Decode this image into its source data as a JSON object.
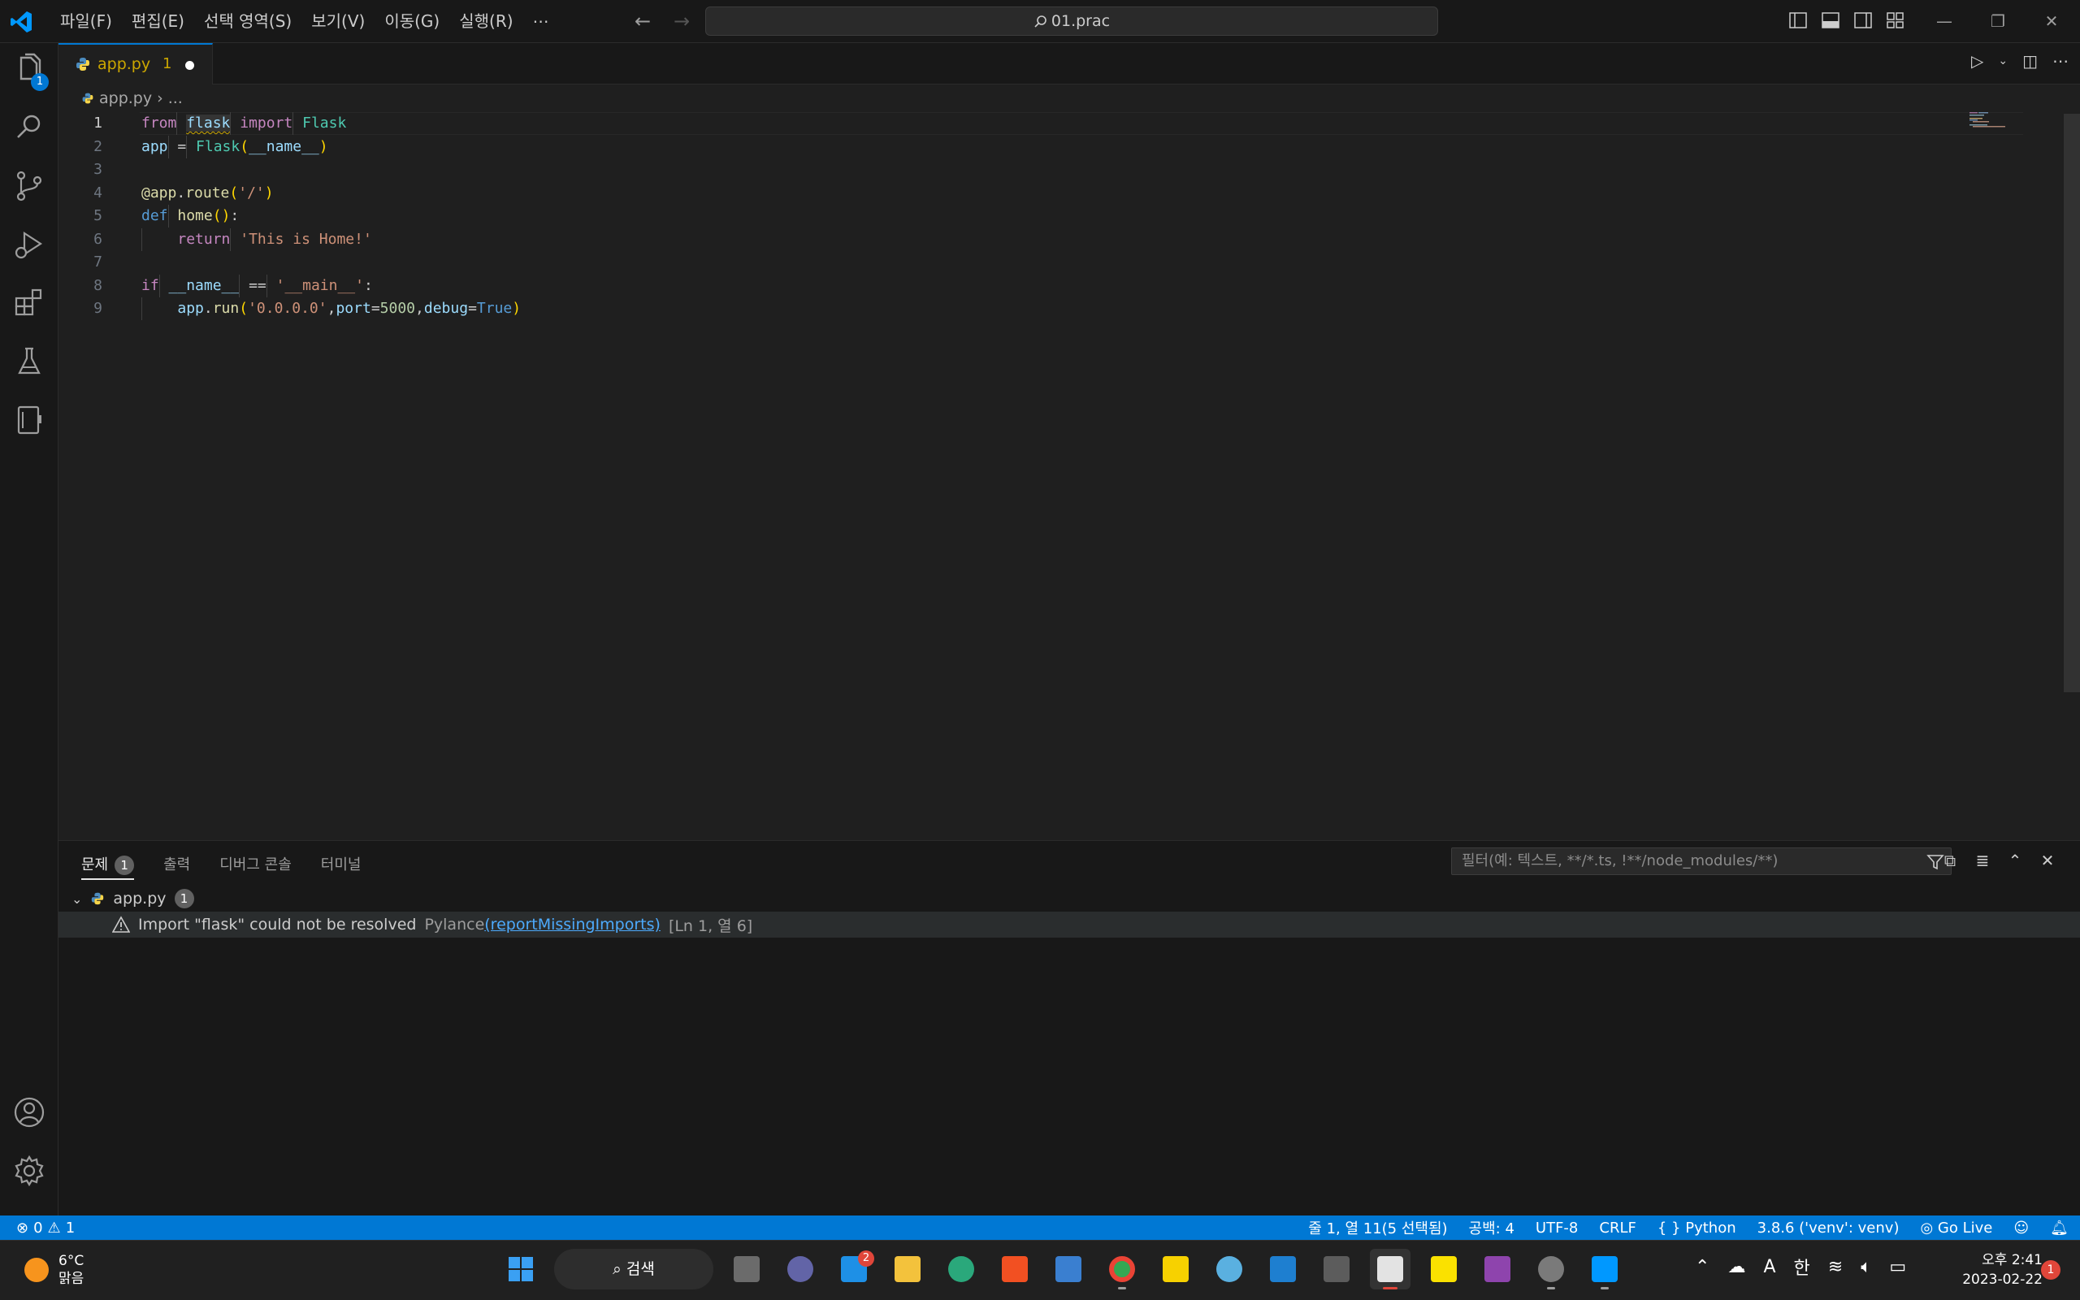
{
  "window": {
    "menus": [
      "파일(F)",
      "편집(E)",
      "선택 영역(S)",
      "보기(V)",
      "이동(G)",
      "실행(R)",
      "⋯"
    ],
    "search_text": "01.prac"
  },
  "activity": {
    "explorer_badge": "1"
  },
  "tab": {
    "name": "app.py",
    "problem_count": "1"
  },
  "breadcrumb": {
    "file": "app.py",
    "rest": "..."
  },
  "editor": {
    "line_numbers": [
      "1",
      "2",
      "3",
      "4",
      "5",
      "6",
      "7",
      "8",
      "9"
    ],
    "lines": [
      "from flask import Flask",
      "app = Flask(__name__)",
      "",
      "@app.route('/')",
      "def home():",
      "    return 'This is Home!'",
      "",
      "if __name__ == '__main__':",
      "    app.run('0.0.0.0',port=5000,debug=True)"
    ]
  },
  "panel": {
    "tabs": [
      "문제",
      "출력",
      "디버그 콘솔",
      "터미널"
    ],
    "problems_badge": "1",
    "filter_placeholder": "필터(예: 텍스트, **/*.ts, !**/node_modules/**)",
    "file_name": "app.py",
    "file_count": "1",
    "problem": {
      "message": "Import \"flask\" could not be resolved",
      "source": "Pylance",
      "code": "(reportMissingImports)",
      "position": "[Ln 1, 열 6]"
    }
  },
  "statusbar": {
    "errors": "0",
    "warnings": "1",
    "cursor": "줄 1, 열 11(5 선택됨)",
    "spaces": "공백: 4",
    "encoding": "UTF-8",
    "eol": "CRLF",
    "language": "Python",
    "interpreter": "3.8.6 ('venv': venv)",
    "golive": "Go Live"
  },
  "taskbar": {
    "temperature": "6°C",
    "weather": "맑음",
    "search_label": "검색",
    "mail_badge": "2",
    "ime": "한",
    "font_icon": "A",
    "time": "오후 2:41",
    "date": "2023-02-22",
    "notification_count": "1"
  },
  "colors": {
    "accent": "#0078d4",
    "statusbar": "#0078d4",
    "warning": "#cca700",
    "editor_bg": "#1f1f1f"
  }
}
